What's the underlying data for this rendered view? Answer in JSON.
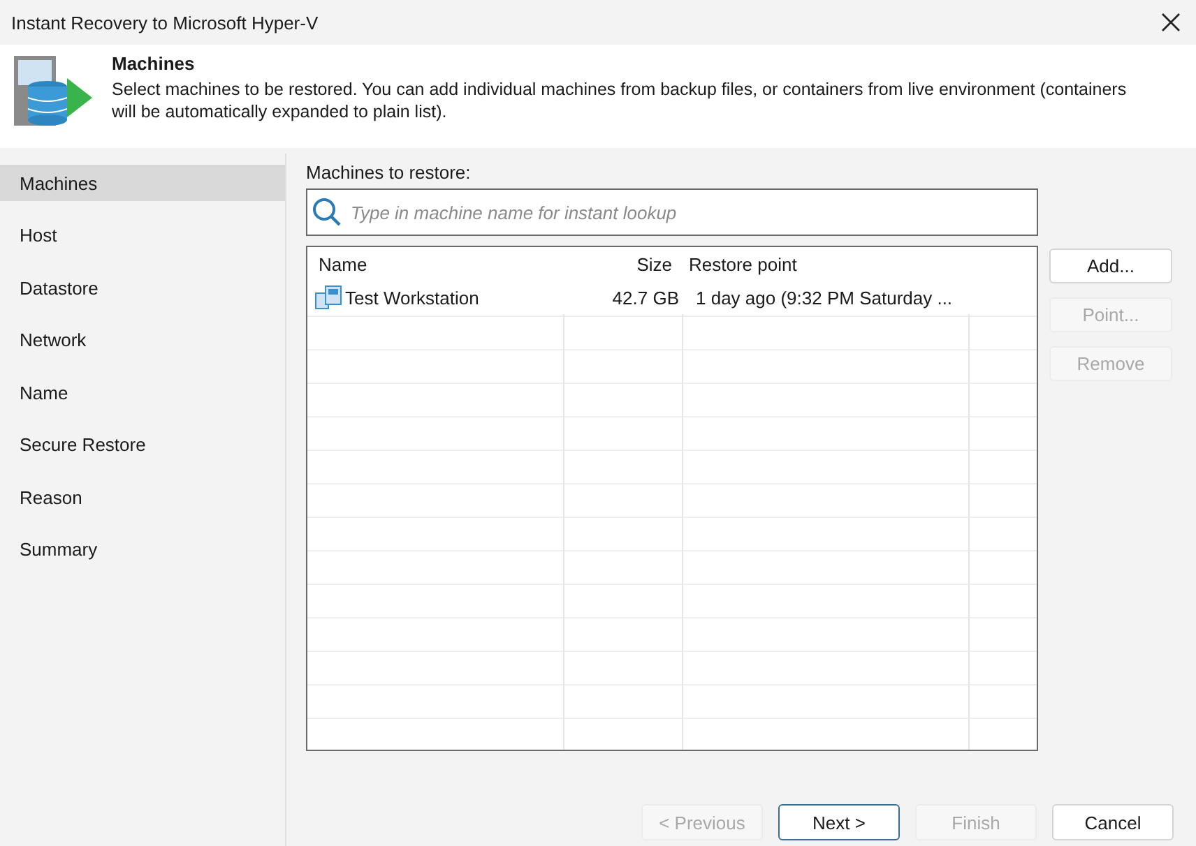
{
  "window": {
    "title": "Instant Recovery to Microsoft Hyper-V"
  },
  "header": {
    "title": "Machines",
    "description": "Select machines to be restored. You can add individual machines from backup files, or containers from live environment (containers will be automatically expanded to plain list)."
  },
  "sidebar": {
    "items": [
      {
        "label": "Machines",
        "selected": true
      },
      {
        "label": "Host",
        "selected": false
      },
      {
        "label": "Datastore",
        "selected": false
      },
      {
        "label": "Network",
        "selected": false
      },
      {
        "label": "Name",
        "selected": false
      },
      {
        "label": "Secure Restore",
        "selected": false
      },
      {
        "label": "Reason",
        "selected": false
      },
      {
        "label": "Summary",
        "selected": false
      }
    ]
  },
  "main": {
    "label": "Machines to restore:",
    "search": {
      "placeholder": "Type in machine name for instant lookup"
    },
    "table": {
      "columns": [
        "Name",
        "Size",
        "Restore point"
      ],
      "rows": [
        {
          "name": "Test Workstation",
          "size": "42.7 GB",
          "restore_point": "1 day ago (9:32 PM Saturday ...",
          "selected": false
        }
      ]
    },
    "side_buttons": [
      {
        "label": "Add...",
        "disabled": false
      },
      {
        "label": "Point...",
        "disabled": true
      },
      {
        "label": "Remove",
        "disabled": true
      }
    ]
  },
  "footer": {
    "buttons": [
      {
        "label": "< Previous",
        "disabled": true,
        "default": false
      },
      {
        "label": "Next >",
        "disabled": false,
        "default": true
      },
      {
        "label": "Finish",
        "disabled": true,
        "default": false
      },
      {
        "label": "Cancel",
        "disabled": false,
        "default": false
      }
    ]
  }
}
